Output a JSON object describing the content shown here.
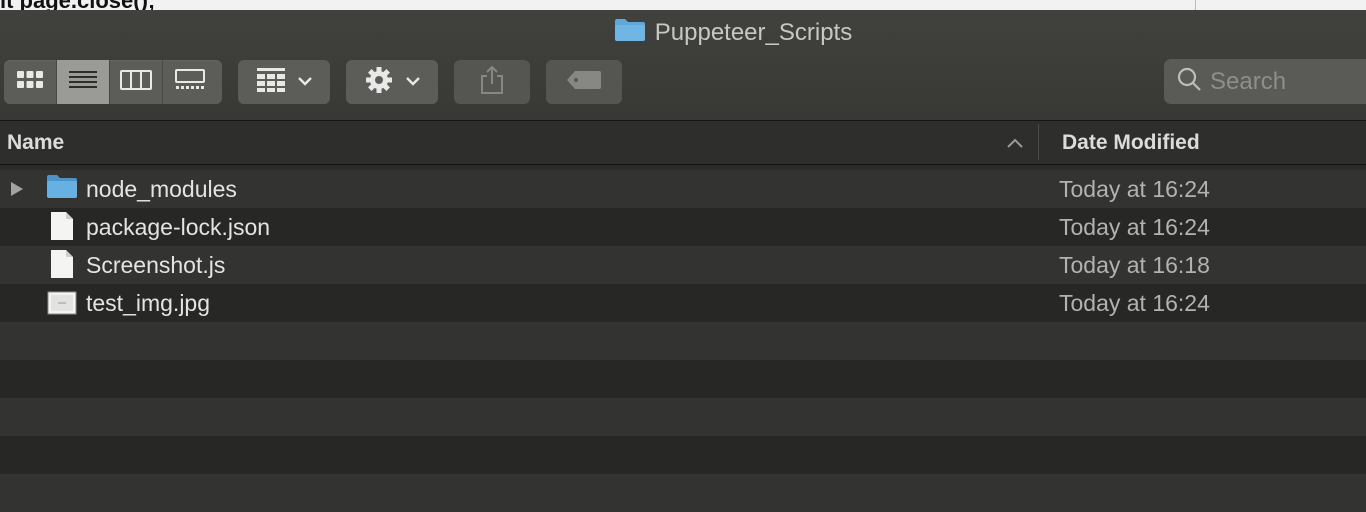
{
  "background_editor": {
    "code_text": "it page.close();"
  },
  "window": {
    "title": "Puppeteer_Scripts"
  },
  "toolbar": {
    "view_modes": [
      {
        "icon": "icon-view-icon",
        "active": false
      },
      {
        "icon": "list-view-icon",
        "active": true
      },
      {
        "icon": "column-view-icon",
        "active": false
      },
      {
        "icon": "gallery-view-icon",
        "active": false
      }
    ],
    "group_button_icon": "group-by-icon",
    "action_button_icon": "gear-icon",
    "share_button_icon": "share-icon",
    "tags_button_icon": "tag-icon",
    "search": {
      "placeholder": "Search",
      "value": ""
    }
  },
  "columns": {
    "name": "Name",
    "date_modified": "Date Modified",
    "sort": "ascending"
  },
  "files": [
    {
      "name": "node_modules",
      "date": "Today at 16:24",
      "type": "folder",
      "expandable": true
    },
    {
      "name": "package-lock.json",
      "date": "Today at 16:24",
      "type": "document",
      "expandable": false
    },
    {
      "name": "Screenshot.js",
      "date": "Today at 16:18",
      "type": "document",
      "expandable": false
    },
    {
      "name": "test_img.jpg",
      "date": "Today at 16:24",
      "type": "image",
      "expandable": false
    }
  ],
  "colors": {
    "folder_blue": "#5fa8d9",
    "window_bg": "#2b2b29",
    "active_segment": "#9a9a97"
  }
}
